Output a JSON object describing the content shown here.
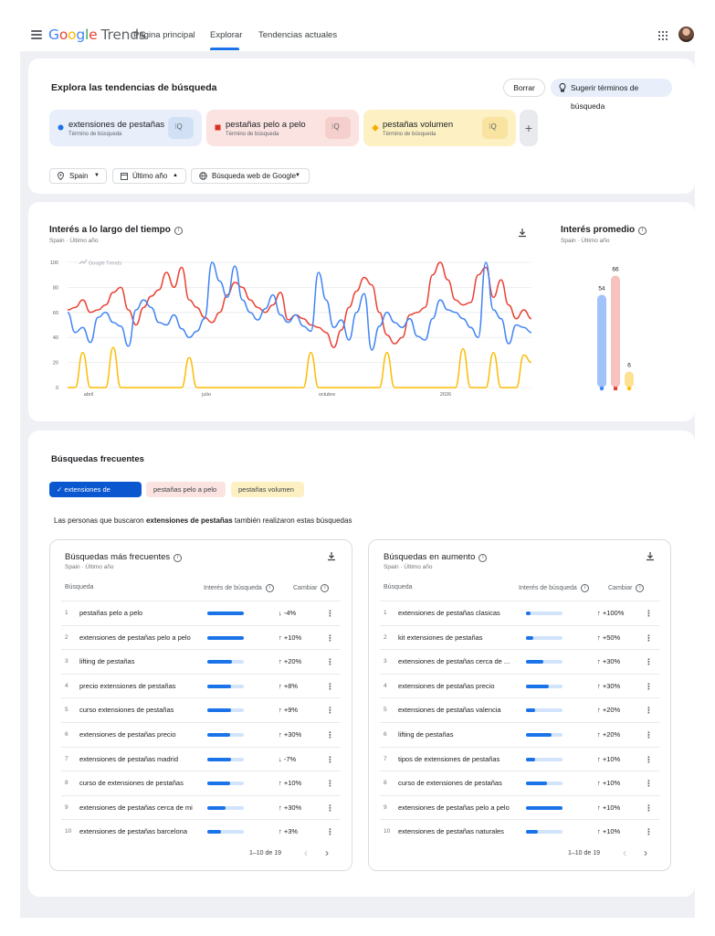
{
  "header": {
    "logo_word": "Google",
    "logo_product": "Trends",
    "nav": [
      "Página principal",
      "Explorar",
      "Tendencias actuales"
    ],
    "active_nav": "Explorar"
  },
  "explore": {
    "title": "Explora las tendencias de búsqueda",
    "clear_label": "Borrar",
    "suggest_label": "Sugerir términos de búsqueda",
    "terms": [
      {
        "name": "extensiones de pestañas",
        "type": "Término de búsqueda",
        "color": "#1a73e8",
        "marker": "circle"
      },
      {
        "name": "pestañas pelo a pelo",
        "type": "Término de búsqueda",
        "color": "#d93025",
        "marker": "square"
      },
      {
        "name": "pestañas volumen",
        "type": "Término de búsqueda",
        "color": "#f9ab00",
        "marker": "diamond"
      }
    ],
    "add_label": "+",
    "filters": {
      "region": "Spain",
      "period": "Último año",
      "source": "Búsqueda web de Google"
    }
  },
  "interest_over_time": {
    "title": "Interés a lo largo del tiempo",
    "meta": "Spain · Último año",
    "watermark": "Google Trends"
  },
  "average_interest": {
    "title": "Interés promedio",
    "meta": "Spain · Último año"
  },
  "chart_data": {
    "type": "line",
    "y_ticks": [
      0,
      20,
      40,
      60,
      80,
      100
    ],
    "x_tick_labels": [
      "abril",
      "julio",
      "octubre",
      "2026"
    ],
    "ylim": [
      0,
      100
    ],
    "series": [
      {
        "name": "extensiones de pestañas",
        "color": "#4285f4",
        "values": [
          60,
          44,
          48,
          36,
          56,
          60,
          52,
          49,
          33,
          62,
          70,
          64,
          52,
          50,
          58,
          47,
          40,
          45,
          55,
          100,
          85,
          72,
          97,
          70,
          60,
          54,
          63,
          74,
          58,
          52,
          58,
          49,
          45,
          92,
          70,
          48,
          54,
          38,
          60,
          75,
          30,
          49,
          60,
          52,
          48,
          55,
          41,
          38,
          55,
          70,
          62,
          60,
          55,
          48,
          40,
          100,
          62,
          55,
          35,
          50,
          48,
          44
        ]
      },
      {
        "name": "pestañas pelo a pelo",
        "color": "#ea4335",
        "values": [
          62,
          64,
          70,
          60,
          62,
          66,
          76,
          80,
          62,
          50,
          64,
          73,
          78,
          92,
          80,
          96,
          70,
          64,
          56,
          52,
          60,
          74,
          84,
          80,
          70,
          64,
          60,
          66,
          76,
          54,
          58,
          55,
          50,
          48,
          44,
          32,
          46,
          64,
          77,
          88,
          82,
          60,
          42,
          35,
          40,
          58,
          60,
          64,
          90,
          100,
          86,
          70,
          66,
          68,
          90,
          96,
          72,
          86,
          66,
          55,
          62,
          55
        ]
      },
      {
        "name": "pestañas volumen",
        "color": "#fbbc05",
        "values": [
          0,
          0,
          28,
          0,
          0,
          0,
          32,
          0,
          0,
          0,
          0,
          0,
          0,
          0,
          0,
          0,
          24,
          0,
          0,
          0,
          0,
          0,
          0,
          0,
          0,
          0,
          0,
          0,
          0,
          0,
          0,
          0,
          28,
          0,
          0,
          0,
          0,
          0,
          0,
          0,
          0,
          0,
          28,
          0,
          0,
          0,
          0,
          0,
          0,
          0,
          0,
          0,
          31,
          0,
          0,
          0,
          28,
          0,
          0,
          0,
          26,
          20
        ]
      }
    ],
    "averages": [
      {
        "term": "extensiones de pestañas",
        "value": 54,
        "color": "#4285f4"
      },
      {
        "term": "pestañas pelo a pelo",
        "value": 66,
        "color": "#ea4335"
      },
      {
        "term": "pestañas volumen",
        "value": 6,
        "color": "#fbbc05"
      }
    ]
  },
  "related": {
    "title": "Búsquedas frecuentes",
    "tabs": [
      "extensiones de pesta...",
      "pestañas pelo a pelo",
      "pestañas volumen"
    ],
    "desc_prefix": "Las personas que buscaron",
    "desc_term": "extensiones de pestañas",
    "desc_suffix": "también realizaron estas búsquedas",
    "top": {
      "title": "Búsquedas más frecuentes",
      "meta": "Spain · Último año",
      "col_query": "Búsqueda",
      "col_interest": "Interés de búsqueda",
      "col_change": "Cambiar",
      "rows": [
        {
          "n": "1",
          "q": "pestañas pelo a pelo",
          "interest": 1.0,
          "change": "↓  -4%"
        },
        {
          "n": "2",
          "q": "extensiones de pestañas pelo a pelo",
          "interest": 1.0,
          "change": "↑ +10%"
        },
        {
          "n": "3",
          "q": "lifting de pestañas",
          "interest": 0.68,
          "change": "↑ +20%"
        },
        {
          "n": "4",
          "q": "precio extensiones de pestañas",
          "interest": 0.66,
          "change": "↑  +8%"
        },
        {
          "n": "5",
          "q": "curso extensiones de pestañas",
          "interest": 0.64,
          "change": "↑  +9%"
        },
        {
          "n": "6",
          "q": "extensiones de pestañas precio",
          "interest": 0.62,
          "change": "↑ +30%"
        },
        {
          "n": "7",
          "q": "extensiones de pestañas madrid",
          "interest": 0.64,
          "change": "↓  -7%"
        },
        {
          "n": "8",
          "q": "curso de extensiones de pestañas",
          "interest": 0.62,
          "change": "↑ +10%"
        },
        {
          "n": "9",
          "q": "extensiones de pestañas cerca de mi",
          "interest": 0.5,
          "change": "↑ +30%"
        },
        {
          "n": "10",
          "q": "extensiones de pestañas barcelona",
          "interest": 0.38,
          "change": "↑  +3%"
        }
      ],
      "pager": "1–10 de 19"
    },
    "rising": {
      "title": "Búsquedas en aumento",
      "meta": "Spain · Último año",
      "col_query": "Búsqueda",
      "col_interest": "Interés de búsqueda",
      "col_change": "Cambiar",
      "rows": [
        {
          "n": "1",
          "q": "extensiones de pestañas clasicas",
          "interest": 0.12,
          "change": "↑ +100%"
        },
        {
          "n": "2",
          "q": "kit extensiones de pestañas",
          "interest": 0.2,
          "change": "↑  +50%"
        },
        {
          "n": "3",
          "q": "extensiones de pestañas cerca de ...",
          "interest": 0.48,
          "change": "↑  +30%"
        },
        {
          "n": "4",
          "q": "extensiones de pestañas precio",
          "interest": 0.62,
          "change": "↑  +30%"
        },
        {
          "n": "5",
          "q": "extensiones de pestañas valencia",
          "interest": 0.26,
          "change": "↑  +20%"
        },
        {
          "n": "6",
          "q": "lifting de pestañas",
          "interest": 0.7,
          "change": "↑  +20%"
        },
        {
          "n": "7",
          "q": "tipos de extensiones de pestañas",
          "interest": 0.26,
          "change": "↑  +10%"
        },
        {
          "n": "8",
          "q": "curso de extensiones de pestañas",
          "interest": 0.58,
          "change": "↑  +10%"
        },
        {
          "n": "9",
          "q": "extensiones de pestañas pelo a pelo",
          "interest": 1.0,
          "change": "↑  +10%"
        },
        {
          "n": "10",
          "q": "extensiones de pestañas naturales",
          "interest": 0.32,
          "change": "↑  +10%"
        }
      ],
      "pager": "1–10 de 19"
    }
  }
}
